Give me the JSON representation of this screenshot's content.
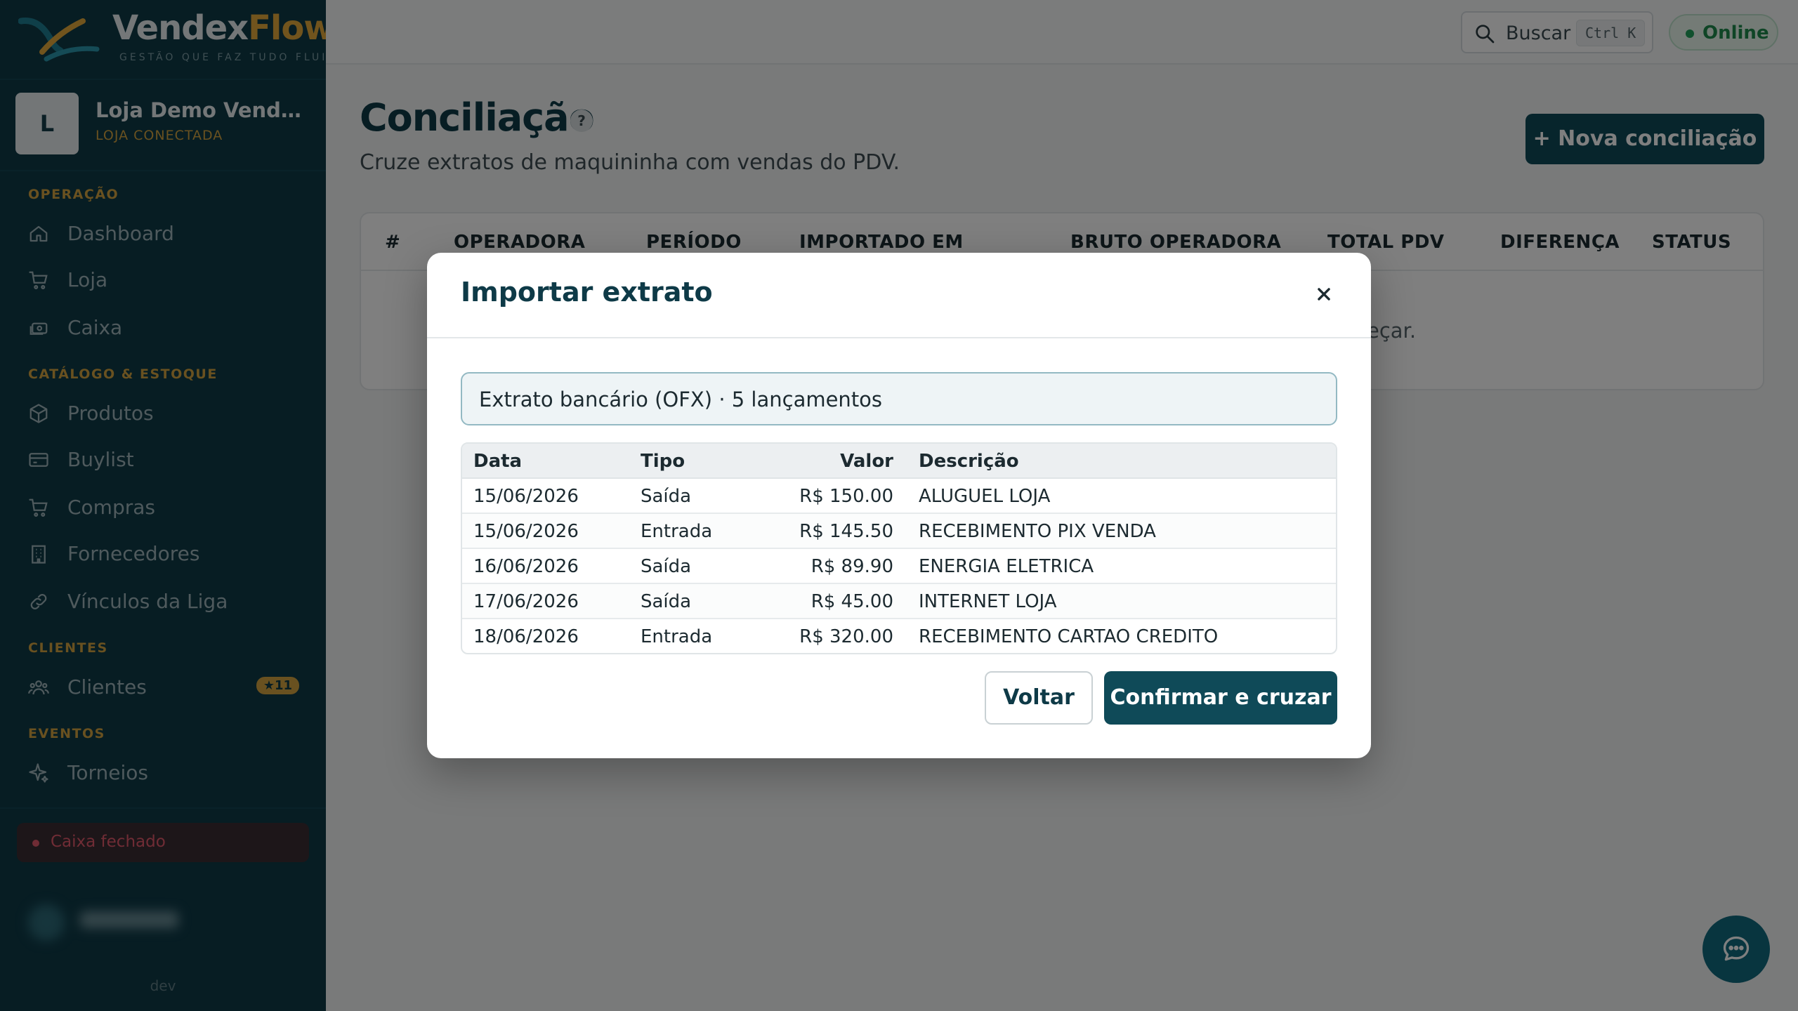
{
  "brand": {
    "name_part1": "Vendex",
    "name_part2": "Flow",
    "tagline": "GESTÃO QUE FAZ TUDO FLUIR"
  },
  "store": {
    "avatar_letter": "L",
    "name": "Loja Demo VendexFlow",
    "status": "LOJA CONECTADA"
  },
  "sidebar": {
    "sections": [
      {
        "title": "OPERAÇÃO",
        "items": [
          {
            "label": "Dashboard",
            "icon": "home-icon"
          },
          {
            "label": "Loja",
            "icon": "cart-icon"
          },
          {
            "label": "Caixa",
            "icon": "register-icon"
          }
        ]
      },
      {
        "title": "CATÁLOGO & ESTOQUE",
        "items": [
          {
            "label": "Produtos",
            "icon": "box-icon"
          },
          {
            "label": "Buylist",
            "icon": "card-icon"
          },
          {
            "label": "Compras",
            "icon": "cart-icon"
          },
          {
            "label": "Fornecedores",
            "icon": "building-icon"
          },
          {
            "label": "Vínculos da Liga",
            "icon": "link-icon"
          }
        ]
      },
      {
        "title": "CLIENTES",
        "items": [
          {
            "label": "Clientes",
            "icon": "users-icon",
            "badge": "★11"
          }
        ]
      },
      {
        "title": "EVENTOS",
        "items": [
          {
            "label": "Torneios",
            "icon": "sparkle-icon"
          }
        ]
      }
    ],
    "cash_status": "Caixa fechado",
    "env": "dev"
  },
  "topbar": {
    "search_label": "Buscar",
    "search_shortcut": "Ctrl K",
    "status": "Online"
  },
  "page": {
    "title": "Conciliação",
    "help": "?",
    "subtitle": "Cruze extratos de maquininha com vendas do PDV.",
    "new_button": "+ Nova conciliação",
    "table_headers": [
      "#",
      "OPERADORA",
      "PERÍODO",
      "IMPORTADO EM",
      "BRUTO OPERADORA",
      "TOTAL PDV",
      "DIFERENÇA",
      "STATUS"
    ],
    "empty_visible_fragment": "eçar."
  },
  "modal": {
    "title": "Importar extrato",
    "file_info": "Extrato bancário (OFX) · 5 lançamentos",
    "columns": {
      "date": "Data",
      "type": "Tipo",
      "value": "Valor",
      "description": "Descrição"
    },
    "rows": [
      {
        "date": "15/06/2026",
        "type": "Saída",
        "value": "R$ 150.00",
        "description": "ALUGUEL LOJA"
      },
      {
        "date": "15/06/2026",
        "type": "Entrada",
        "value": "R$ 145.50",
        "description": "RECEBIMENTO PIX VENDA"
      },
      {
        "date": "16/06/2026",
        "type": "Saída",
        "value": "R$ 89.90",
        "description": "ENERGIA ELETRICA"
      },
      {
        "date": "17/06/2026",
        "type": "Saída",
        "value": "R$ 45.00",
        "description": "INTERNET LOJA"
      },
      {
        "date": "18/06/2026",
        "type": "Entrada",
        "value": "R$ 320.00",
        "description": "RECEBIMENTO CARTAO CREDITO"
      }
    ],
    "back_button": "Voltar",
    "confirm_button": "Confirmar e cruzar"
  },
  "colors": {
    "sidebar": "#0e3a47",
    "accent": "#d2a340",
    "primary_button": "#0f4a58",
    "online": "#20a05a",
    "danger": "#e0586a"
  }
}
